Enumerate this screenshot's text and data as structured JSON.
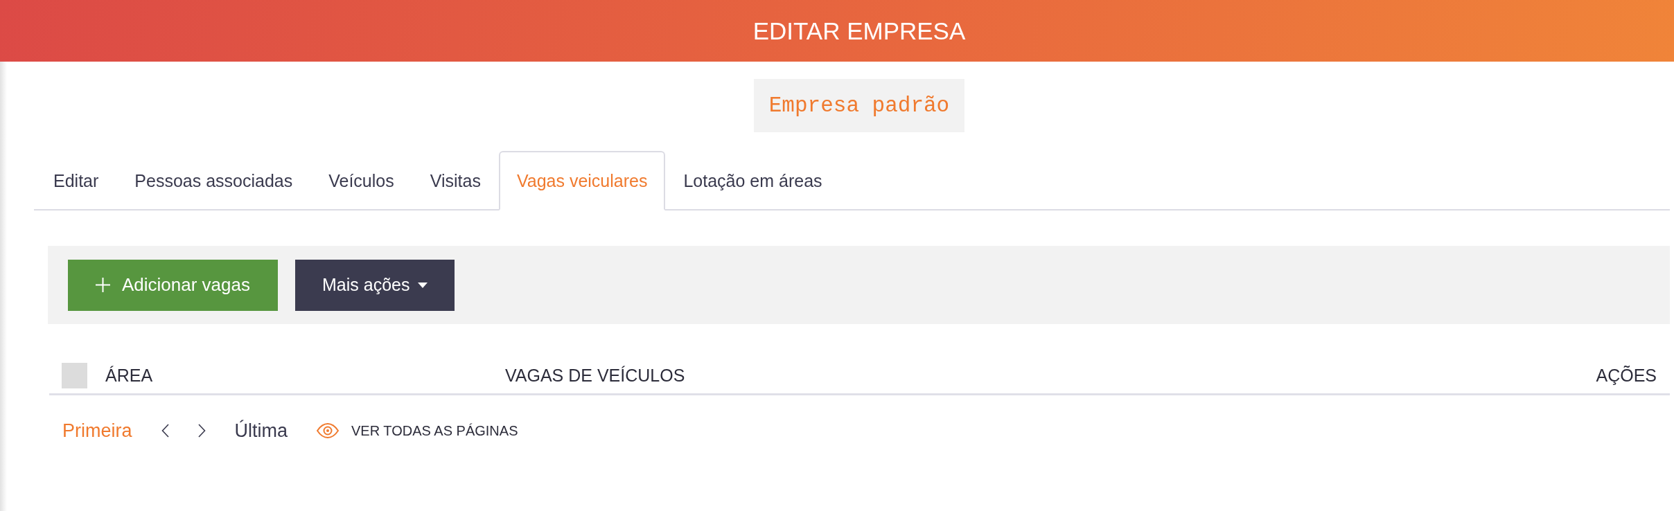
{
  "header": {
    "title": "EDITAR EMPRESA"
  },
  "company_name": "Empresa padrão",
  "tabs": [
    {
      "label": "Editar",
      "selected": false
    },
    {
      "label": "Pessoas associadas",
      "selected": false
    },
    {
      "label": "Veículos",
      "selected": false
    },
    {
      "label": "Visitas",
      "selected": false
    },
    {
      "label": "Vagas veiculares",
      "selected": true
    },
    {
      "label": "Lotação em áreas",
      "selected": false
    }
  ],
  "toolbar": {
    "buttons": [
      {
        "kind": "add",
        "label": "Adicionar vagas"
      },
      {
        "kind": "menu",
        "label": "Mais ações"
      }
    ]
  },
  "table": {
    "select_all": {
      "checked": false
    },
    "columns": [
      "ÁREA",
      "VAGAS DE VEÍCULOS",
      "AÇÕES"
    ]
  },
  "pagination": {
    "items": [
      {
        "kind": "link",
        "label": "Primeira",
        "active": true
      },
      {
        "kind": "previous"
      },
      {
        "kind": "next"
      },
      {
        "kind": "link",
        "label": "Última",
        "active": false
      }
    ],
    "view_all": "VER TODAS AS PÁGINAS"
  }
}
